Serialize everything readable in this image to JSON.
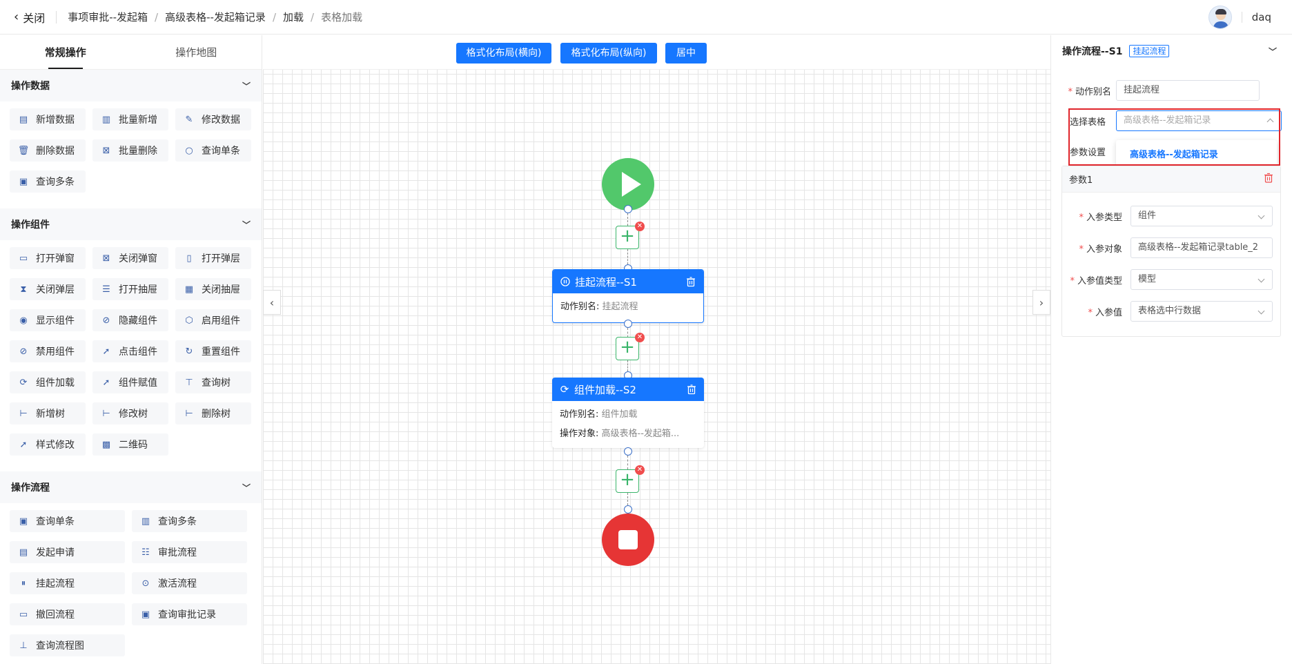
{
  "header": {
    "close_label": "关闭",
    "breadcrumb": [
      "事项审批--发起箱",
      "高级表格--发起箱记录",
      "加载",
      "表格加载"
    ],
    "user_name": "daq"
  },
  "left_tabs": [
    "常规操作",
    "操作地图"
  ],
  "sections": {
    "data": {
      "title": "操作数据",
      "items": [
        "新增数据",
        "批量新增",
        "修改数据",
        "删除数据",
        "批量删除",
        "查询单条",
        "查询多条"
      ]
    },
    "component": {
      "title": "操作组件",
      "items": [
        "打开弹窗",
        "关闭弹窗",
        "打开弹层",
        "关闭弹层",
        "打开抽屉",
        "关闭抽屉",
        "显示组件",
        "隐藏组件",
        "启用组件",
        "禁用组件",
        "点击组件",
        "重置组件",
        "组件加载",
        "组件赋值",
        "查询树",
        "新增树",
        "修改树",
        "删除树",
        "样式修改",
        "二维码"
      ]
    },
    "flow": {
      "title": "操作流程",
      "items": [
        "查询单条",
        "查询多条",
        "发起申请",
        "审批流程",
        "挂起流程",
        "激活流程",
        "撤回流程",
        "查询审批记录",
        "查询流程图"
      ]
    }
  },
  "toolbar": {
    "layout_h": "格式化布局(横向)",
    "layout_v": "格式化布局(纵向)",
    "center": "居中"
  },
  "nodes": {
    "s1": {
      "title": "挂起流程--S1",
      "alias_key": "动作别名:",
      "alias_val": "挂起流程"
    },
    "s2": {
      "title": "组件加载--S2",
      "alias_key": "动作别名:",
      "alias_val": "组件加载",
      "target_key": "操作对象:",
      "target_val": "高级表格--发起箱..."
    }
  },
  "right": {
    "title": "操作流程--S1",
    "tag": "挂起流程",
    "alias_label": "动作别名",
    "alias_value": "挂起流程",
    "table_label": "选择表格",
    "table_placeholder": "高级表格--发起箱记录",
    "dropdown_option": "高级表格--发起箱记录",
    "param_label": "参数设置",
    "param_title": "参数1",
    "fields": [
      {
        "label": "入参类型",
        "value": "组件"
      },
      {
        "label": "入参对象",
        "value": "高级表格--发起箱记录table_2"
      },
      {
        "label": "入参值类型",
        "value": "模型"
      },
      {
        "label": "入参值",
        "value": "表格选中行数据"
      }
    ]
  },
  "colors": {
    "primary": "#1677ff",
    "start": "#52c86b",
    "end": "#e63535",
    "highlight": "#e0242b"
  }
}
